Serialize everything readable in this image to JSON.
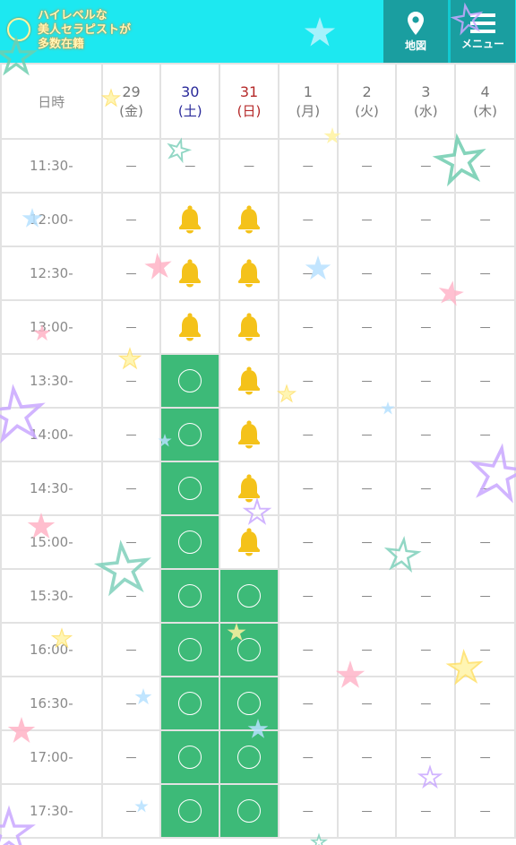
{
  "header": {
    "logo_lines": [
      "ハイレベルな",
      "美人セラピストが",
      "多数在籍"
    ],
    "map_label": "地図",
    "menu_label": "メニュー"
  },
  "colors": {
    "open": "#3dba78",
    "header": "#1de8f0",
    "buttons": "#1a9ea0",
    "bell": "#f4c21a"
  },
  "schedule": {
    "corner_label": "日時",
    "days": [
      {
        "num": "29",
        "wd": "(金)",
        "kind": "wk"
      },
      {
        "num": "30",
        "wd": "(土)",
        "kind": "sat"
      },
      {
        "num": "31",
        "wd": "(日)",
        "kind": "sun"
      },
      {
        "num": "1",
        "wd": "(月)",
        "kind": "wk"
      },
      {
        "num": "2",
        "wd": "(火)",
        "kind": "wk"
      },
      {
        "num": "3",
        "wd": "(水)",
        "kind": "wk"
      },
      {
        "num": "4",
        "wd": "(木)",
        "kind": "wk"
      }
    ],
    "empty_mark": "－",
    "rows": [
      {
        "time": "11:30-",
        "cells": [
          "-",
          "-",
          "-",
          "-",
          "-",
          "-",
          "-"
        ]
      },
      {
        "time": "12:00-",
        "cells": [
          "-",
          "bell",
          "bell",
          "-",
          "-",
          "-",
          "-"
        ]
      },
      {
        "time": "12:30-",
        "cells": [
          "-",
          "bell",
          "bell",
          "-",
          "-",
          "-",
          "-"
        ]
      },
      {
        "time": "13:00-",
        "cells": [
          "-",
          "bell",
          "bell",
          "-",
          "-",
          "-",
          "-"
        ]
      },
      {
        "time": "13:30-",
        "cells": [
          "-",
          "open",
          "bell",
          "-",
          "-",
          "-",
          "-"
        ]
      },
      {
        "time": "14:00-",
        "cells": [
          "-",
          "open",
          "bell",
          "-",
          "-",
          "-",
          "-"
        ]
      },
      {
        "time": "14:30-",
        "cells": [
          "-",
          "open",
          "bell",
          "-",
          "-",
          "-",
          "-"
        ]
      },
      {
        "time": "15:00-",
        "cells": [
          "-",
          "open",
          "bell",
          "-",
          "-",
          "-",
          "-"
        ]
      },
      {
        "time": "15:30-",
        "cells": [
          "-",
          "open",
          "open",
          "-",
          "-",
          "-",
          "-"
        ]
      },
      {
        "time": "16:00-",
        "cells": [
          "-",
          "open",
          "open",
          "-",
          "-",
          "-",
          "-"
        ]
      },
      {
        "time": "16:30-",
        "cells": [
          "-",
          "open",
          "open",
          "-",
          "-",
          "-",
          "-"
        ]
      },
      {
        "time": "17:00-",
        "cells": [
          "-",
          "open",
          "open",
          "-",
          "-",
          "-",
          "-"
        ]
      },
      {
        "time": "17:30-",
        "cells": [
          "-",
          "open",
          "open",
          "-",
          "-",
          "-",
          "-"
        ]
      }
    ]
  }
}
